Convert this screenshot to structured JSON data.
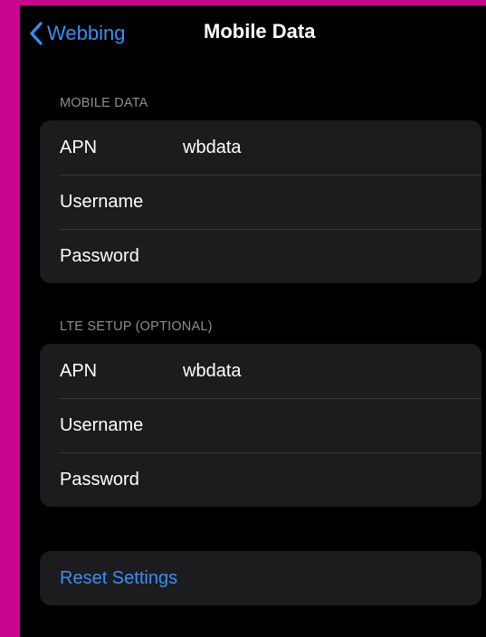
{
  "colors": {
    "frame": "#c9068f",
    "background": "#000000",
    "cell": "#1c1c1e",
    "separator": "#38383a",
    "accent": "#3a8ef6",
    "secondary_text": "#8e8e93"
  },
  "navbar": {
    "back_icon": "chevron-left-icon",
    "back_label": "Webbing",
    "title": "Mobile Data"
  },
  "mobile_data": {
    "header": "MOBILE DATA",
    "apn_label": "APN",
    "apn_value": "wbdata",
    "username_label": "Username",
    "username_value": "",
    "password_label": "Password",
    "password_value": ""
  },
  "lte_setup": {
    "header": "LTE SETUP (OPTIONAL)",
    "apn_label": "APN",
    "apn_value": "wbdata",
    "username_label": "Username",
    "username_value": "",
    "password_label": "Password",
    "password_value": ""
  },
  "reset": {
    "label": "Reset Settings"
  }
}
